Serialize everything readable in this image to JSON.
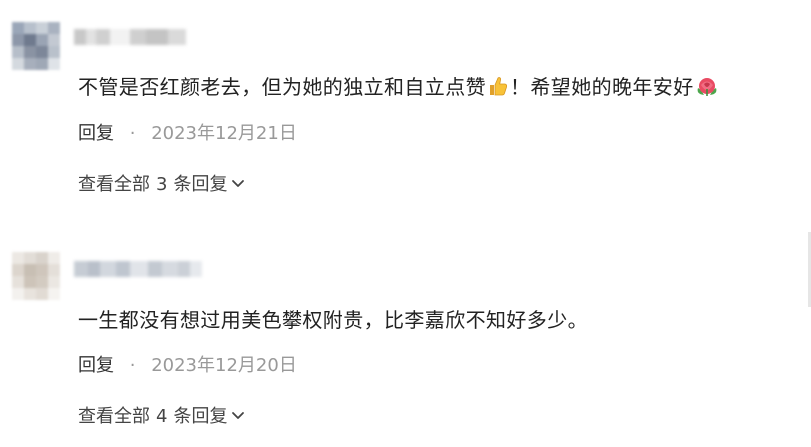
{
  "comments": [
    {
      "text_before": "不管是否红颜老去，但为她的独立和自立点赞",
      "emoji_1": "thumbs-up",
      "text_middle": "！希望她的晚年安好",
      "emoji_2": "rose",
      "reply_label": "回复",
      "separator": "·",
      "date": "2023年12月21日",
      "view_prefix": "查看全部",
      "reply_count": "3",
      "view_suffix": "条回复"
    },
    {
      "text_before": "一生都没有想过用美色攀权附贵，比李嘉欣不知好多少。",
      "reply_label": "回复",
      "separator": "·",
      "date": "2023年12月20日",
      "view_prefix": "查看全部",
      "reply_count": "4",
      "view_suffix": "条回复"
    }
  ],
  "colors": {
    "text": "#222222",
    "meta": "#999999",
    "link": "#444444"
  },
  "icons": {
    "avatar": "blurred-avatar",
    "chevron": "chevron-down-icon"
  }
}
